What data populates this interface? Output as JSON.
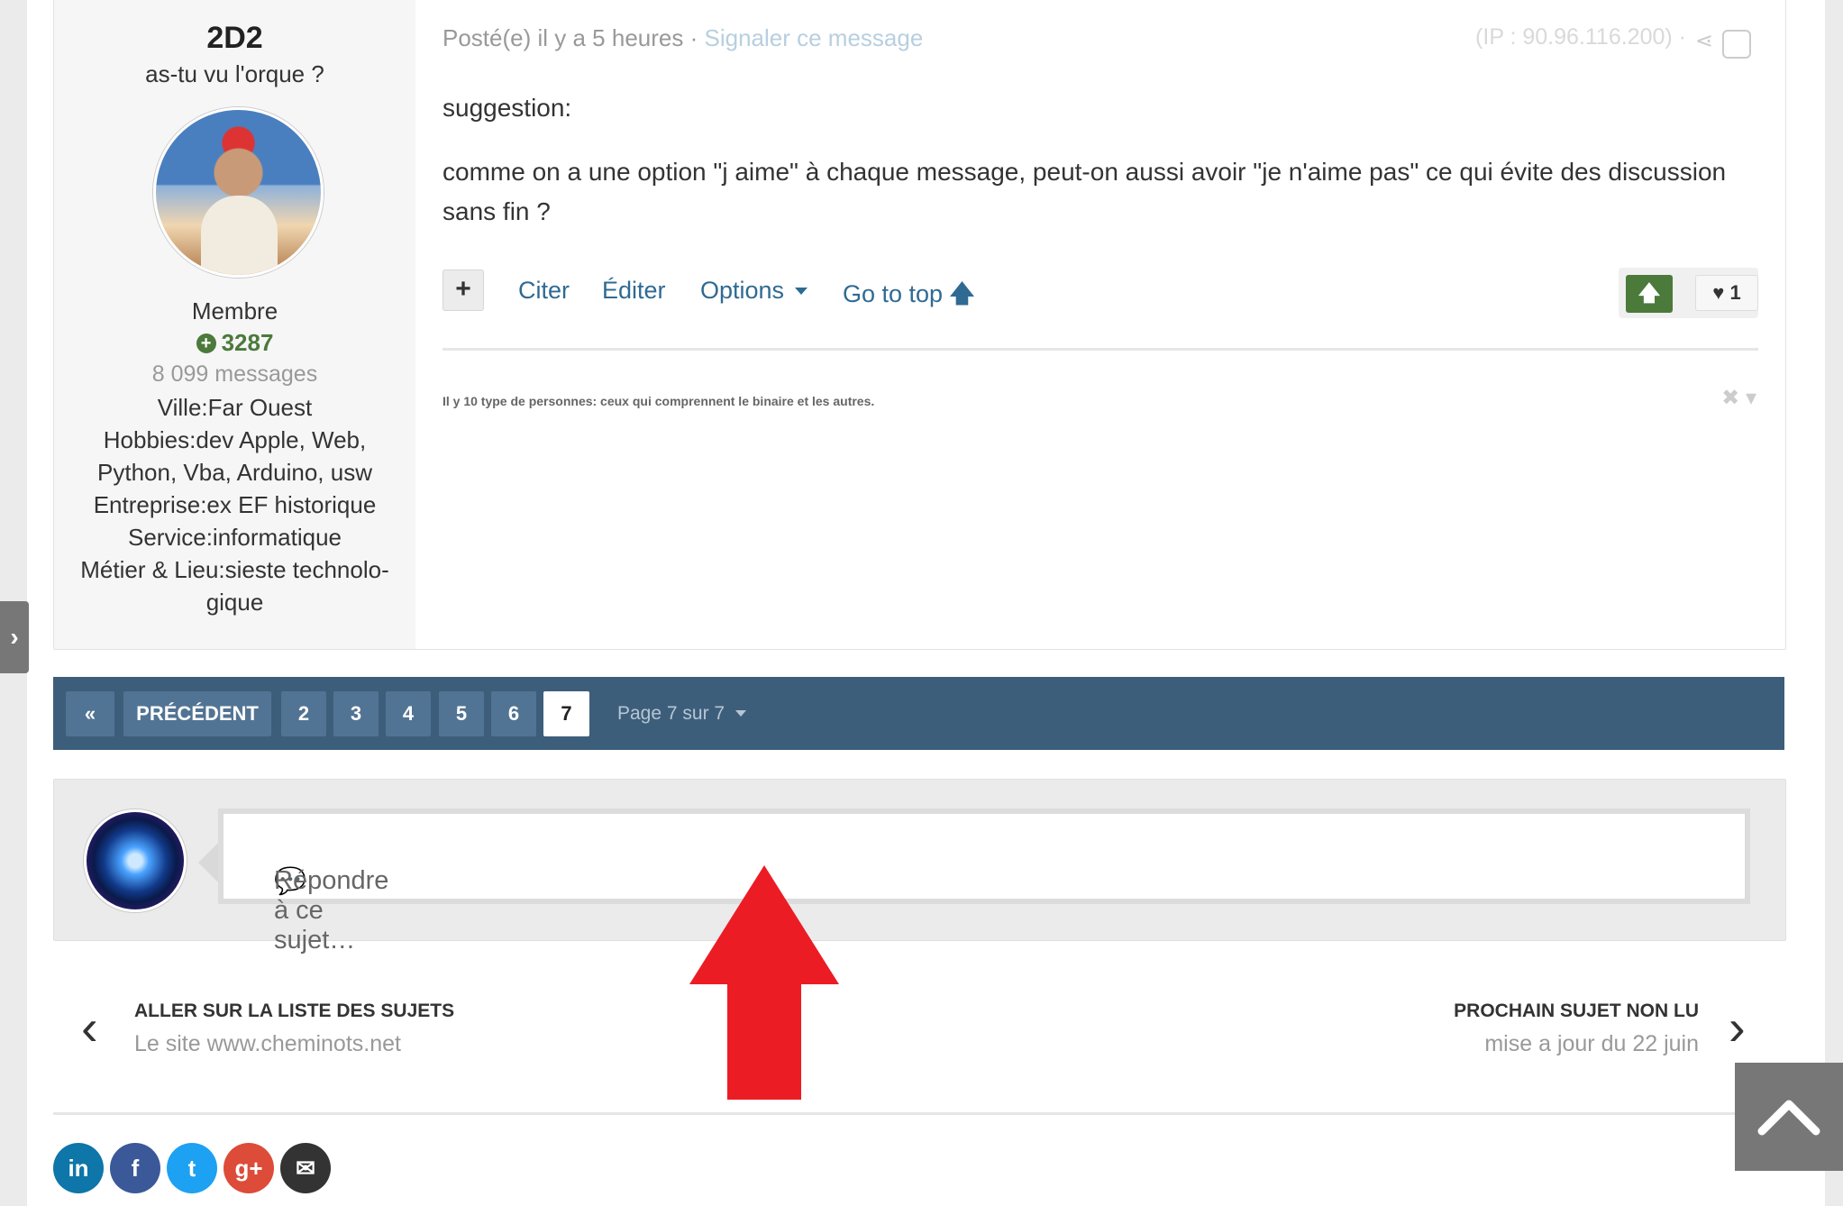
{
  "author": {
    "name": "2D2",
    "title": "as-tu vu l'orque ?",
    "group": "Membre",
    "reputation": "3287",
    "posts": "8 099 messages",
    "fields": [
      "Ville:Far Ouest",
      "Hobbies:dev Apple, Web, Python, Vba, Arduino, usw",
      "Entreprise:ex EF historique",
      "Service:informatique",
      "Métier & Lieu:sieste technolo-gique"
    ]
  },
  "post": {
    "posted": "Posté(e) il y a 5 heures",
    "separator": "·",
    "report": "Signaler ce message",
    "ip": "(IP : 90.96.116.200) ·",
    "text1": "suggestion:",
    "text2": "comme on a une option \"j aime\" à chaque message, peut-on aussi avoir \"je n'aime pas\" ce qui évite des discussion sans fin ?",
    "actions": {
      "quote": "Citer",
      "edit": "Éditer",
      "options": "Options",
      "top": "Go to top"
    },
    "likes": "1",
    "signature": "Il y 10 type de personnes: ceux qui comprennent le binaire et les autres."
  },
  "pagination": {
    "first": "«",
    "prev": "PRÉCÉDENT",
    "pages": [
      "2",
      "3",
      "4",
      "5",
      "6",
      "7"
    ],
    "active": "7",
    "info": "Page 7 sur 7"
  },
  "reply": {
    "placeholder": "Répondre à ce sujet…"
  },
  "nav": {
    "prev_title": "ALLER SUR LA LISTE DES SUJETS",
    "prev_sub": "Le site www.cheminots.net",
    "next_title": "PROCHAIN SUJET NON LU",
    "next_sub": "mise a jour du 22 juin"
  },
  "social": [
    {
      "icon": "linkedin-icon",
      "glyph": "in",
      "color": "#0e76a8"
    },
    {
      "icon": "facebook-icon",
      "glyph": "f",
      "color": "#3b5998"
    },
    {
      "icon": "twitter-icon",
      "glyph": "t",
      "color": "#1da1f2"
    },
    {
      "icon": "googleplus-icon",
      "glyph": "g+",
      "color": "#dd4b39"
    },
    {
      "icon": "email-icon",
      "glyph": "✉",
      "color": "#333333"
    }
  ],
  "colors": {
    "accent": "#3d5e7b",
    "link": "#2f6a93",
    "positive": "#4b7a3b",
    "arrow": "#ec1c24"
  }
}
